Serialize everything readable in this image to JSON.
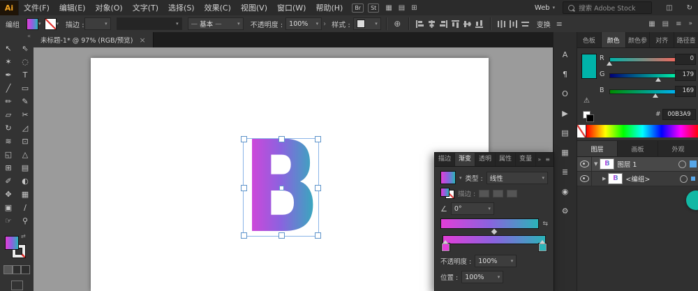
{
  "app": {
    "logo_text": "Ai"
  },
  "menubar": {
    "items": [
      "文件(F)",
      "编辑(E)",
      "对象(O)",
      "文字(T)",
      "选择(S)",
      "效果(C)",
      "视图(V)",
      "窗口(W)",
      "帮助(H)"
    ],
    "badges": [
      "Br",
      "St"
    ],
    "workspace_value": "Web",
    "search_text": "搜索 Adobe Stock"
  },
  "controlbar": {
    "selection_label": "编组",
    "stroke_label": "描边 :",
    "profile_value": "基本",
    "opacity_label": "不透明度 :",
    "opacity_value": "100%",
    "style_label": "样式 :",
    "transform_label": "变换"
  },
  "tabbar": {
    "doc_title": "未标题-1* @ 97% (RGB/预览)",
    "close_glyph": "×"
  },
  "canvas": {
    "letter": "B"
  },
  "toolbar": {
    "tools": [
      {
        "name": "selection-tool",
        "glyph": "↖"
      },
      {
        "name": "direct-selection-tool",
        "glyph": "⇖"
      },
      {
        "name": "magic-wand-tool",
        "glyph": "✶"
      },
      {
        "name": "lasso-tool",
        "glyph": "◌"
      },
      {
        "name": "pen-tool",
        "glyph": "✒"
      },
      {
        "name": "type-tool",
        "glyph": "T"
      },
      {
        "name": "line-segment-tool",
        "glyph": "╱"
      },
      {
        "name": "rectangle-tool",
        "glyph": "▭"
      },
      {
        "name": "paintbrush-tool",
        "glyph": "✏"
      },
      {
        "name": "pencil-tool",
        "glyph": "✎"
      },
      {
        "name": "eraser-tool",
        "glyph": "▱"
      },
      {
        "name": "scissors-tool",
        "glyph": "✂"
      },
      {
        "name": "rotate-tool",
        "glyph": "↻"
      },
      {
        "name": "scale-tool",
        "glyph": "◿"
      },
      {
        "name": "width-tool",
        "glyph": "≋"
      },
      {
        "name": "free-transform-tool",
        "glyph": "⊡"
      },
      {
        "name": "shape-builder-tool",
        "glyph": "◱"
      },
      {
        "name": "perspective-grid-tool",
        "glyph": "△"
      },
      {
        "name": "mesh-tool",
        "glyph": "⊞"
      },
      {
        "name": "gradient-tool",
        "glyph": "▤"
      },
      {
        "name": "eyedropper-tool",
        "glyph": "✐"
      },
      {
        "name": "blend-tool",
        "glyph": "◐"
      },
      {
        "name": "symbol-sprayer-tool",
        "glyph": "✥"
      },
      {
        "name": "column-graph-tool",
        "glyph": "▦"
      },
      {
        "name": "artboard-tool",
        "glyph": "▣"
      },
      {
        "name": "slice-tool",
        "glyph": "∕"
      },
      {
        "name": "hand-tool",
        "glyph": "☞"
      },
      {
        "name": "zoom-tool",
        "glyph": "⚲"
      }
    ]
  },
  "icon_strip": [
    {
      "name": "character-panel-icon",
      "glyph": "A"
    },
    {
      "name": "paragraph-panel-icon",
      "glyph": "¶"
    },
    {
      "name": "opentype-panel-icon",
      "glyph": "O"
    },
    {
      "name": "actions-panel-icon",
      "glyph": "▶"
    },
    {
      "name": "libraries-panel-icon",
      "glyph": "▤"
    },
    {
      "name": "swatches-panel-icon",
      "glyph": "▦"
    },
    {
      "name": "appearance-panel-icon",
      "glyph": "≣"
    },
    {
      "name": "symbols-panel-icon",
      "glyph": "◉"
    },
    {
      "name": "asset-export-panel-icon",
      "glyph": "⚙"
    }
  ],
  "gradient_panel": {
    "tabs": [
      "描边",
      "渐变",
      "透明",
      "属性",
      "变量"
    ],
    "active_tab": "渐变",
    "type_label": "类型 :",
    "type_value": "线性",
    "stroke_label": "描边 :",
    "angle_value": "0°",
    "opacity_label": "不透明度 :",
    "opacity_value": "100%",
    "position_label": "位置 :",
    "position_value": "100%"
  },
  "color_panel": {
    "tabs": [
      "色板",
      "颜色",
      "颜色参",
      "对齐",
      "路径查"
    ],
    "active_tab": "颜色",
    "channels": [
      {
        "label": "R",
        "value": "0"
      },
      {
        "label": "G",
        "value": "179"
      },
      {
        "label": "B",
        "value": "169"
      }
    ],
    "hex_prefix": "#",
    "hex_value": "00B3A9",
    "swatch_color": "#00B3A9"
  },
  "layers_panel": {
    "tabs": [
      "图层",
      "画板",
      "外观"
    ],
    "active_tab": "图层",
    "rows": [
      {
        "name": "图层 1",
        "depth": 0,
        "expanded": true
      },
      {
        "name": "<编组>",
        "depth": 1,
        "expanded": false
      }
    ]
  },
  "colors": {
    "gradient_start": "#E23ED8",
    "gradient_mid": "#8A63DF",
    "gradient_end": "#2BB3B8",
    "selection_blue": "#7EB1E8",
    "layer_indicator_blue": "#57A7E8"
  }
}
